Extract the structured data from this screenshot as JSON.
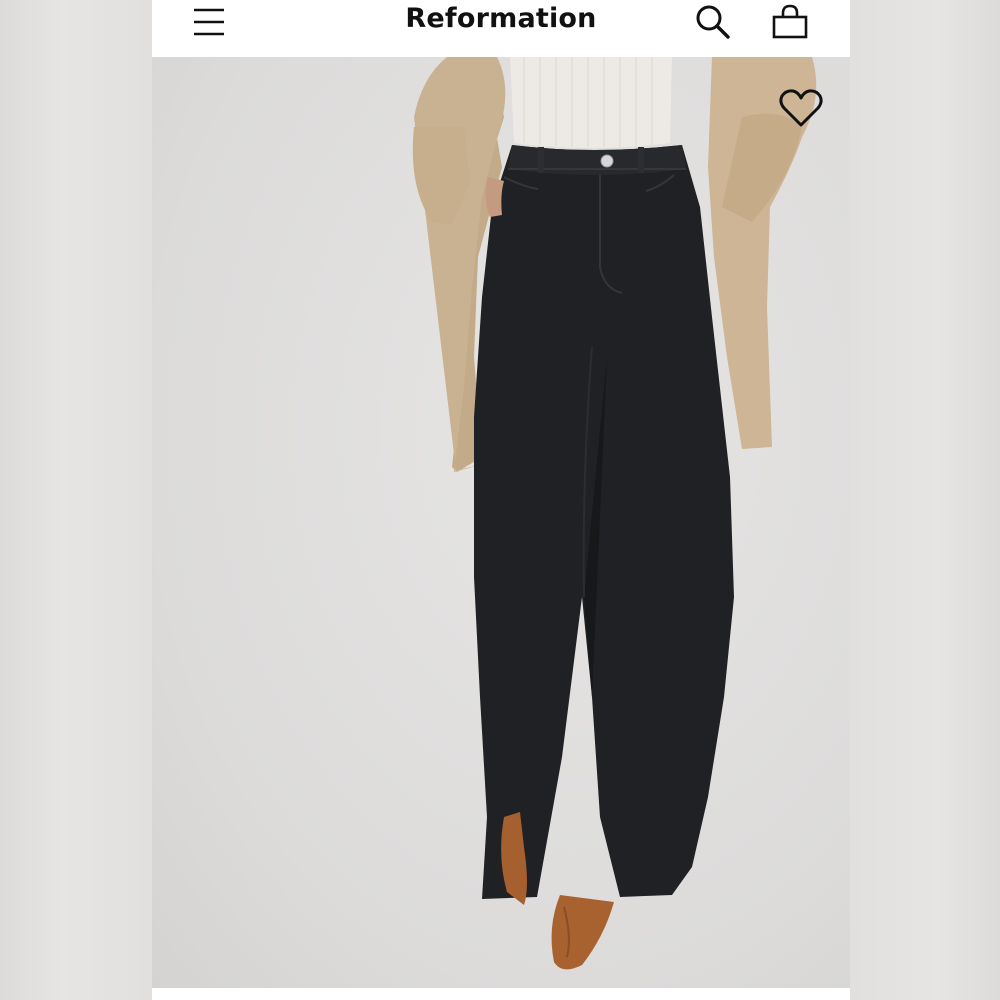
{
  "header": {
    "brand": "Reformation",
    "menu_icon": "hamburger-menu-icon",
    "search_icon": "search-icon",
    "bag_icon": "shopping-bag-icon"
  },
  "product_image": {
    "wishlist_icon": "heart-outline-icon"
  },
  "colors": {
    "background": "#ffffff",
    "text": "#111111",
    "jeans": "#1f2124",
    "coat": "#c8b08f",
    "boots": "#a65f2f"
  }
}
